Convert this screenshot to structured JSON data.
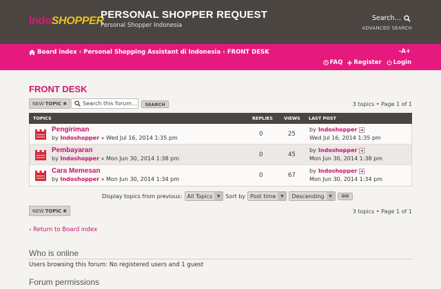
{
  "header": {
    "logo_part1": "Indo",
    "logo_part2": "SHOPPER",
    "site_title": "PERSONAL SHOPPER REQUEST",
    "site_subtitle": "Personal Shopper Indonesia",
    "search_label": "Search…",
    "advanced_search": "ADVANCED SEARCH"
  },
  "navbar": {
    "breadcrumb": [
      "Board index",
      "Personal Shopping Assistant di Indonesia",
      "FRONT DESK"
    ],
    "separator": "‹",
    "font_size_control": "-A+",
    "faq": "FAQ",
    "register": "Register",
    "login": "Login"
  },
  "forum": {
    "title": "FRONT DESK",
    "new_topic_prefix": "NEW",
    "new_topic_suffix": "TOPIC",
    "search_placeholder": "Search this forum…",
    "search_button": "SEARCH",
    "pagination": "3 topics • Page 1 of 1"
  },
  "table": {
    "headers": {
      "topics": "TOPICS",
      "replies": "REPLIES",
      "views": "VIEWS",
      "last_post": "LAST POST"
    },
    "rows": [
      {
        "title": "Pengiriman",
        "by": "by",
        "author": "Indoshopper",
        "date": "» Wed Jul 16, 2014 1:35 pm",
        "replies": "0",
        "views": "25",
        "last_by": "by",
        "last_author": "Indoshopper",
        "last_date": "Wed Jul 16, 2014 1:35 pm"
      },
      {
        "title": "Pembayaran",
        "by": "by",
        "author": "Indoshopper",
        "date": "» Mon Jun 30, 2014 1:38 pm",
        "replies": "0",
        "views": "45",
        "last_by": "by",
        "last_author": "Indoshopper",
        "last_date": "Mon Jun 30, 2014 1:38 pm"
      },
      {
        "title": "Cara Memesan",
        "by": "by",
        "author": "Indoshopper",
        "date": "» Mon Jun 30, 2014 1:34 pm",
        "replies": "0",
        "views": "67",
        "last_by": "by",
        "last_author": "Indoshopper",
        "last_date": "Mon Jun 30, 2014 1:34 pm"
      }
    ]
  },
  "display_options": {
    "label": "Display topics from previous:",
    "topics_value": "All Topics",
    "sort_label": "Sort by",
    "sort_value": "Post time",
    "order_value": "Descending",
    "go": "GO"
  },
  "footer": {
    "return_link": "Return to Board index",
    "who_online_heading": "Who is online",
    "who_online_text": "Users browsing this forum: No registered users and 1 guest",
    "permissions_heading": "Forum permissions"
  },
  "colors": {
    "header_bg": "#4b4542",
    "accent_pink": "#e6197e",
    "link_pink": "#c51470",
    "logo_yellow": "#e9c31d"
  },
  "icons": [
    "home-icon",
    "search-icon",
    "help-icon",
    "plus-icon",
    "power-icon",
    "topic-icon",
    "view-latest-post-icon",
    "star-icon"
  ]
}
